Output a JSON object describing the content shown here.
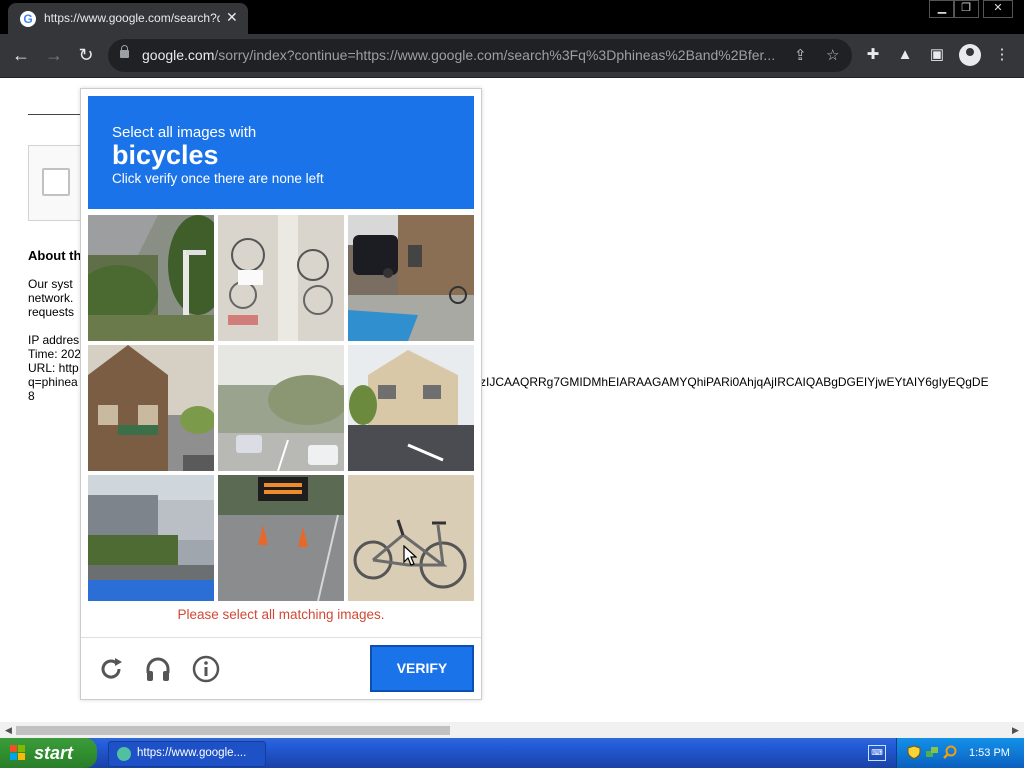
{
  "browser": {
    "tab": {
      "title": "https://www.google.com/search?q=",
      "favicon_icon": "google-g-icon"
    },
    "url": {
      "host": "google.com",
      "path": "/sorry/index?continue=https://www.google.com/search%3Fq%3Dphineas%2Band%2Bfer..."
    }
  },
  "page": {
    "about_heading": "About th",
    "para": [
      "Our syst",
      "network.",
      "requests"
    ],
    "info": [
      "IP addres",
      "Time: 202",
      "URL: http",
      "q=phinea",
      "8"
    ],
    "url_tail": "zIJCAAQRRg7GMIDMhEIARAAGAMYQhiPARi0AhjqAjIRCAIQABgDGEIYjwEYtAIY6gIyEQgDE"
  },
  "captcha": {
    "header": {
      "line1": "Select all images with",
      "target": "bicycles",
      "line3": "Click verify once there are none left"
    },
    "tiles": [
      {
        "name": "tile-1",
        "scene": "fence-trees"
      },
      {
        "name": "tile-2",
        "scene": "parked-bicycles"
      },
      {
        "name": "tile-3",
        "scene": "house-car-bicycle"
      },
      {
        "name": "tile-4",
        "scene": "street-buildings"
      },
      {
        "name": "tile-5",
        "scene": "road-cars"
      },
      {
        "name": "tile-6",
        "scene": "house-intersection"
      },
      {
        "name": "tile-7",
        "scene": "street-hedge"
      },
      {
        "name": "tile-8",
        "scene": "road-sign-cones"
      },
      {
        "name": "tile-9",
        "scene": "bicycle"
      }
    ],
    "error": "Please select all matching images.",
    "verify_label": "VERIFY"
  },
  "taskbar": {
    "start_label": "start",
    "task_label": "https://www.google....",
    "clock": "1:53 PM"
  },
  "colors": {
    "accent": "#1a73e8",
    "error": "#d14836"
  }
}
